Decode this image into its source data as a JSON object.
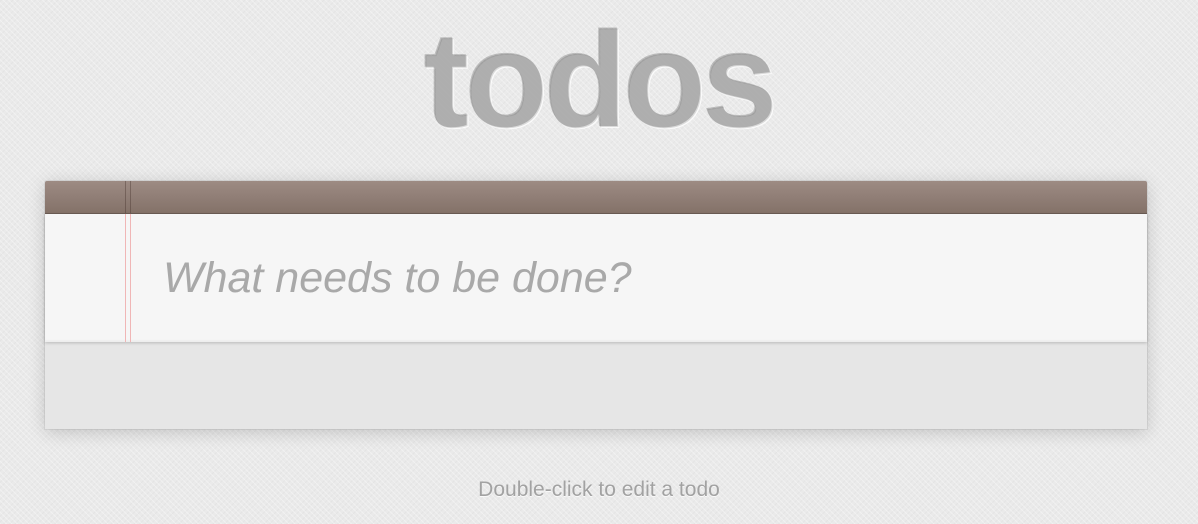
{
  "app": {
    "title": "todos"
  },
  "new_todo": {
    "placeholder": "What needs to be done?",
    "value": ""
  },
  "footer": {
    "info": "Double-click to edit a todo"
  },
  "colors": {
    "header_bar": "#8f7d75",
    "page_background": "#eaeaea",
    "input_background": "#f6f6f6",
    "margin_line": "#f0b6b6",
    "placeholder_text": "#a9a9a9"
  }
}
